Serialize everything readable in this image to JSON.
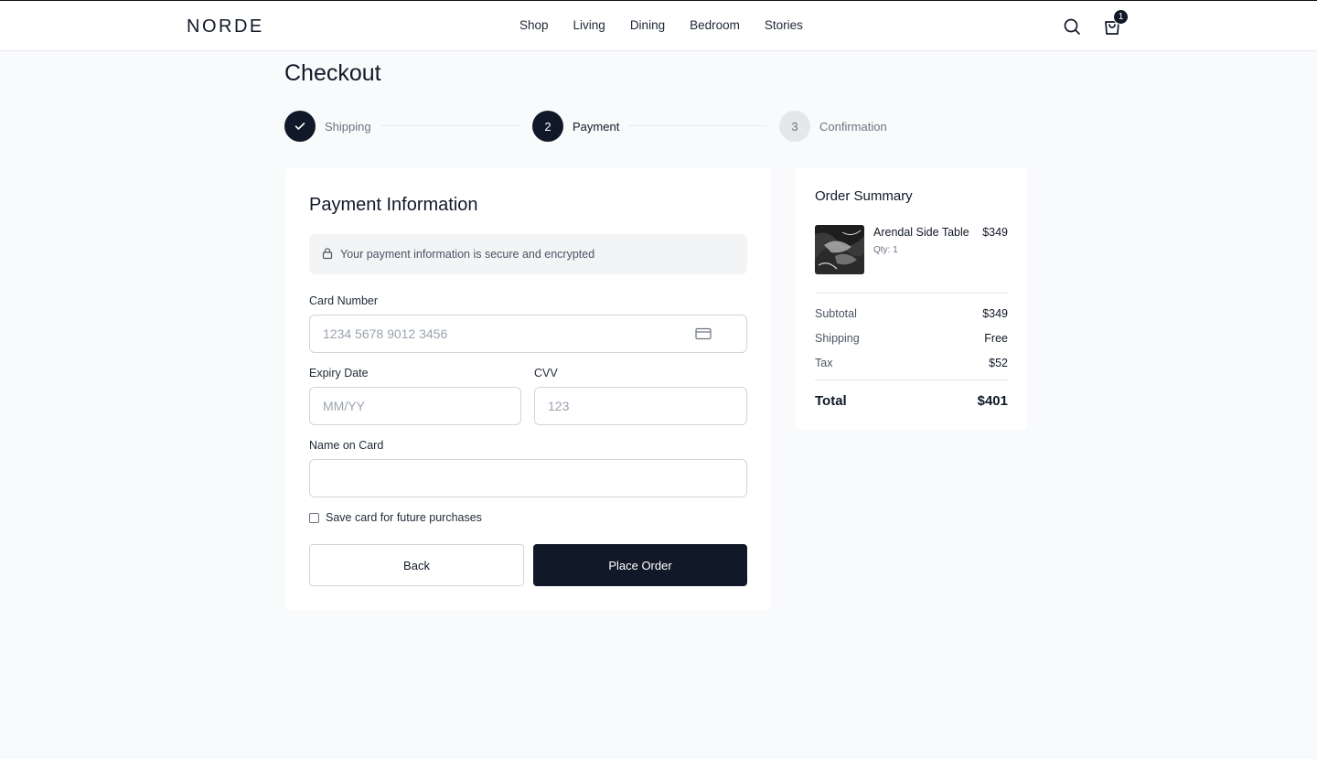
{
  "header": {
    "logo": "NORDE",
    "nav": [
      "Shop",
      "Living",
      "Dining",
      "Bedroom",
      "Stories"
    ],
    "cart_count": "1",
    "icons": {
      "search": "search-icon",
      "cart": "shopping-bag-icon"
    }
  },
  "page": {
    "title": "Checkout"
  },
  "stepper": {
    "steps": [
      {
        "number": "",
        "label": "Shipping",
        "state": "completed",
        "icon": "check-icon"
      },
      {
        "number": "2",
        "label": "Payment",
        "state": "active"
      },
      {
        "number": "3",
        "label": "Confirmation",
        "state": "upcoming"
      }
    ]
  },
  "payment": {
    "title": "Payment Information",
    "secure_note": "Your payment information is secure and encrypted",
    "card_number": {
      "label": "Card Number",
      "placeholder": "1234 5678 9012 3456",
      "value": ""
    },
    "expiry": {
      "label": "Expiry Date",
      "placeholder": "MM/YY",
      "value": ""
    },
    "cvv": {
      "label": "CVV",
      "placeholder": "123",
      "value": ""
    },
    "name_on_card": {
      "label": "Name on Card",
      "placeholder": "",
      "value": ""
    },
    "save_card": {
      "label": "Save card for future purchases",
      "checked": false
    },
    "back_label": "Back",
    "place_order_label": "Place Order"
  },
  "summary": {
    "title": "Order Summary",
    "item": {
      "name": "Arendal Side Table",
      "qty": "Qty: 1",
      "price": "$349"
    },
    "rows": [
      {
        "label": "Subtotal",
        "value": "$349"
      },
      {
        "label": "Shipping",
        "value": "Free"
      },
      {
        "label": "Tax",
        "value": "$52"
      }
    ],
    "total": {
      "label": "Total",
      "value": "$401"
    }
  },
  "colors": {
    "accent": "#111827",
    "background": "#f9fafb",
    "border": "#d1d5db"
  }
}
